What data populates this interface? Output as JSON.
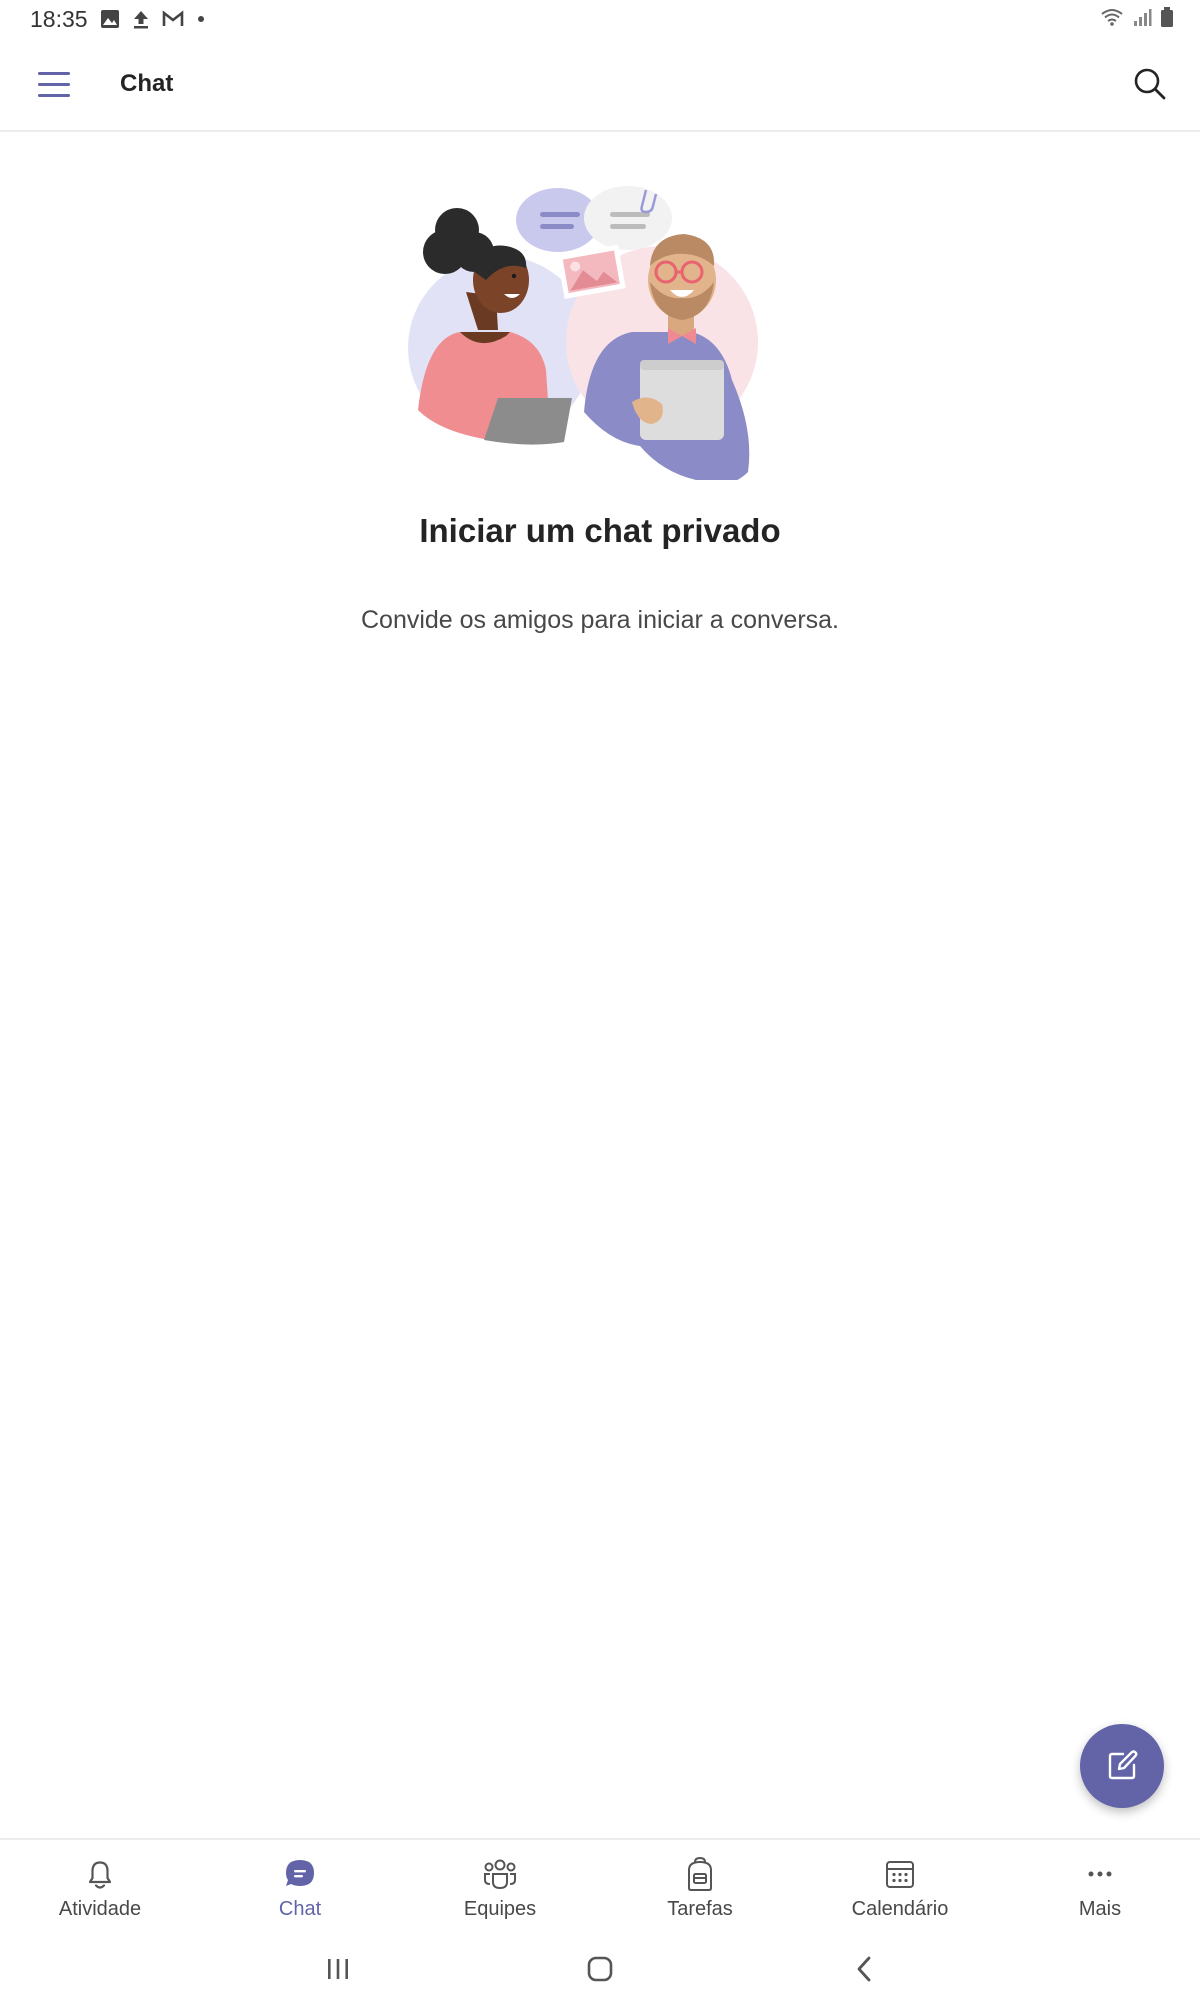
{
  "status_bar": {
    "time": "18:35"
  },
  "header": {
    "title": "Chat",
    "menu_icon": "hamburger-icon",
    "search_icon": "search-icon"
  },
  "empty_state": {
    "title": "Iniciar um chat privado",
    "subtitle": "Convide os amigos para iniciar a conversa."
  },
  "fab": {
    "icon": "compose-icon"
  },
  "bottom_nav": {
    "items": [
      {
        "label": "Atividade",
        "icon": "bell-icon",
        "active": false
      },
      {
        "label": "Chat",
        "icon": "chat-icon",
        "active": true
      },
      {
        "label": "Equipes",
        "icon": "teams-icon",
        "active": false
      },
      {
        "label": "Tarefas",
        "icon": "backpack-icon",
        "active": false
      },
      {
        "label": "Calendário",
        "icon": "calendar-icon",
        "active": false
      },
      {
        "label": "Mais",
        "icon": "more-icon",
        "active": false
      }
    ]
  },
  "colors": {
    "accent": "#6264a7",
    "text": "#242424",
    "muted": "#484848",
    "divider": "#ececec"
  }
}
